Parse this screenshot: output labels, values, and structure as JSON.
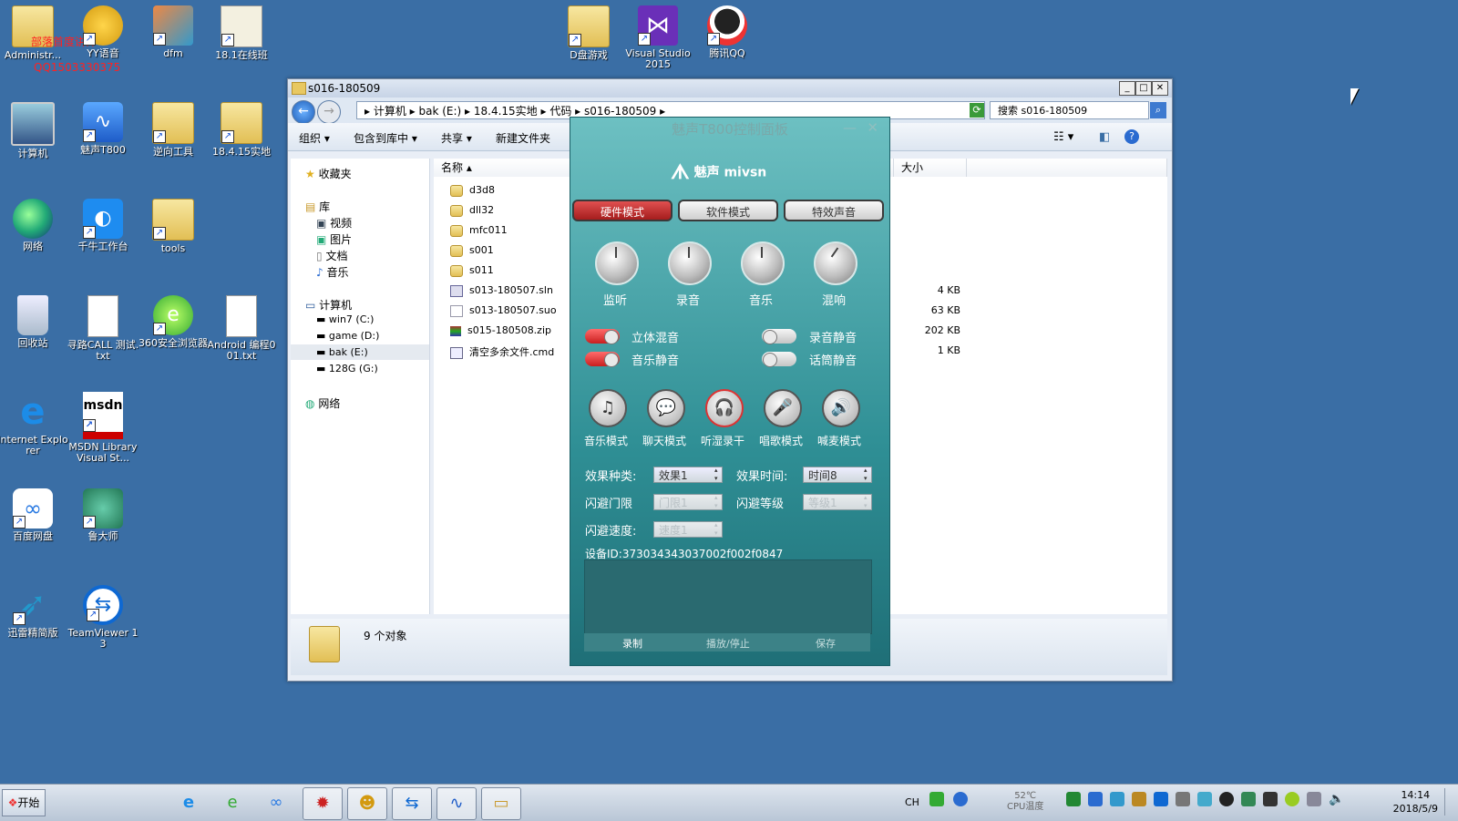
{
  "desktop": {
    "icons": [
      {
        "label": "Administr...",
        "overlay": "部落首度讲师"
      },
      {
        "label": "YY语音",
        "overlay": "QQ1503330375"
      },
      {
        "label": "dfm"
      },
      {
        "label": "18.1在线班"
      },
      {
        "label": "D盘游戏"
      },
      {
        "label": "Visual Studio 2015"
      },
      {
        "label": "腾讯QQ"
      },
      {
        "label": "计算机"
      },
      {
        "label": "魅声T800"
      },
      {
        "label": "逆向工具"
      },
      {
        "label": "18.4.15实地"
      },
      {
        "label": "网络"
      },
      {
        "label": "千牛工作台"
      },
      {
        "label": "tools"
      },
      {
        "label": "回收站"
      },
      {
        "label": "寻路CALL 测试.txt"
      },
      {
        "label": "360安全浏览器"
      },
      {
        "label": "Android 编程001.txt"
      },
      {
        "label": "Internet Explorer"
      },
      {
        "label": "MSDN Library Visual St..."
      },
      {
        "label": "百度网盘"
      },
      {
        "label": "鲁大师"
      },
      {
        "label": "迅雷精简版"
      },
      {
        "label": "TeamViewer 13"
      }
    ]
  },
  "explorer": {
    "title": "s016-180509",
    "address": "▸ 计算机 ▸ bak (E:) ▸ 18.4.15实地 ▸ 代码 ▸ s016-180509 ▸",
    "search_placeholder": "搜索 s016-180509",
    "toolbar": {
      "organize": "组织 ▾",
      "include": "包含到库中 ▾",
      "share": "共享 ▾",
      "new_folder": "新建文件夹"
    },
    "nav": {
      "favorites": "收藏夹",
      "libraries": "库",
      "lib_items": [
        "视频",
        "图片",
        "文档",
        "音乐"
      ],
      "computer": "计算机",
      "drives": [
        "win7 (C:)",
        "game (D:)",
        "bak (E:)",
        "128G (G:)"
      ],
      "network": "网络"
    },
    "columns": {
      "name": "名称",
      "size": "大小"
    },
    "files": [
      {
        "name": "d3d8",
        "size": ""
      },
      {
        "name": "dll32",
        "size": ""
      },
      {
        "name": "mfc011",
        "size": ""
      },
      {
        "name": "s001",
        "size": ""
      },
      {
        "name": "s011",
        "size": ""
      },
      {
        "name": "s013-180507.sln",
        "size": "4 KB"
      },
      {
        "name": "s013-180507.suo",
        "size": "63 KB"
      },
      {
        "name": "s015-180508.zip",
        "size": "202 KB"
      },
      {
        "name": "清空多余文件.cmd",
        "size": "1 KB"
      }
    ],
    "status": "9 个对象"
  },
  "panel": {
    "title": "魅声T800控制面板",
    "logo": "魅声 mivsn",
    "modes": [
      "硬件模式",
      "软件模式",
      "特效声音"
    ],
    "knobs": [
      "监听",
      "录音",
      "音乐",
      "混响"
    ],
    "toggles": [
      {
        "label": "立体混音",
        "on": true
      },
      {
        "label": "录音静音",
        "on": false
      },
      {
        "label": "音乐静音",
        "on": true
      },
      {
        "label": "话筒静音",
        "on": false
      }
    ],
    "modes2": [
      "音乐模式",
      "聊天模式",
      "听湿录干",
      "唱歌模式",
      "喊麦模式"
    ],
    "fields": {
      "effect_type_label": "效果种类:",
      "effect_type": "效果1",
      "effect_time_label": "效果时间:",
      "effect_time": "时间8",
      "flash_gate_label": "闪避门限",
      "flash_gate": "门限1",
      "flash_level_label": "闪避等级",
      "flash_level": "等级1",
      "flash_speed_label": "闪避速度:",
      "flash_speed": "速度1"
    },
    "device_id": "设备ID:373034343037002f002f0847",
    "bottom": [
      "录制",
      "播放/停止",
      "保存"
    ]
  },
  "taskbar": {
    "start": "开始",
    "lang": "CH",
    "temp": "52℃",
    "temp_label": "CPU温度",
    "time": "14:14",
    "date": "2018/5/9"
  }
}
